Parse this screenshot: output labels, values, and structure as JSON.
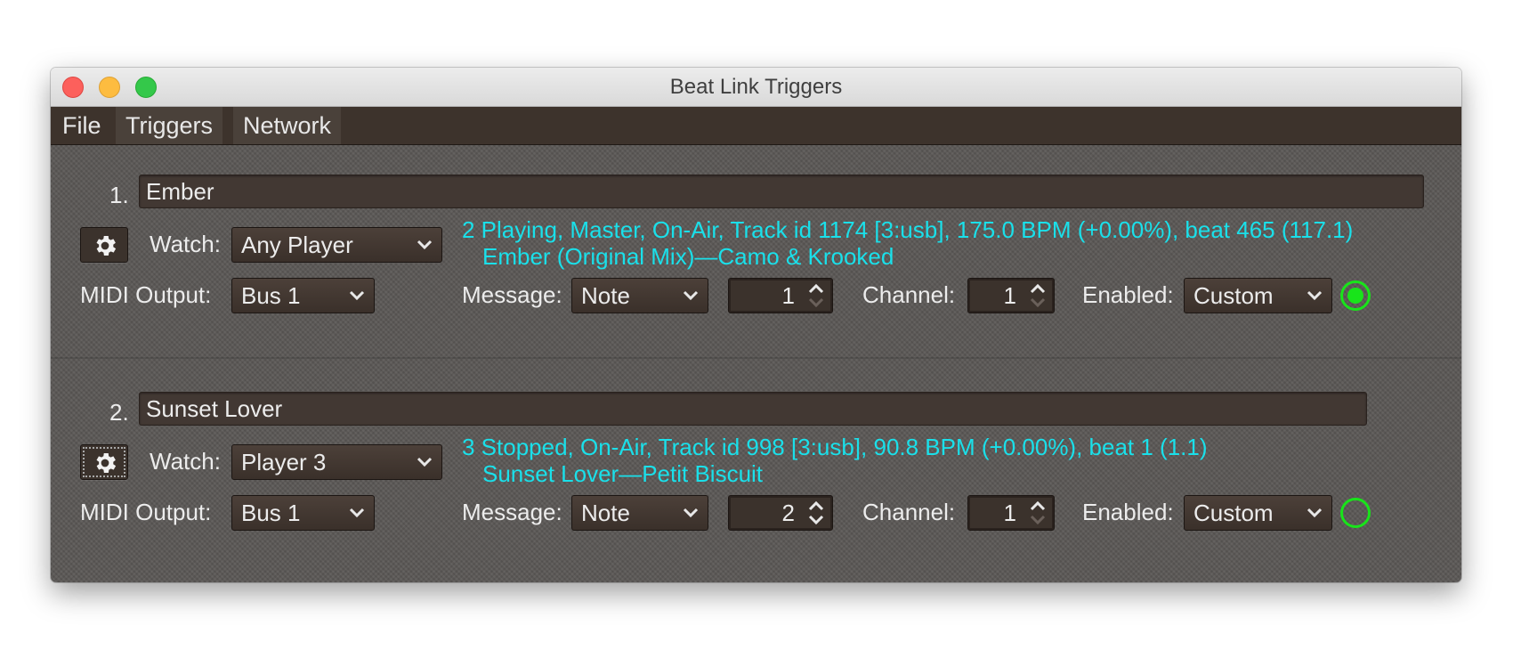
{
  "window": {
    "title": "Beat Link Triggers"
  },
  "menubar": [
    "File",
    "Triggers",
    "Network"
  ],
  "labels": {
    "watch": "Watch:",
    "midi_output": "MIDI Output:",
    "message": "Message:",
    "channel": "Channel:",
    "enabled": "Enabled:"
  },
  "triggers": [
    {
      "index": "1.",
      "name": "Ember",
      "watch": "Any Player",
      "status_line1": "2 Playing, Master, On-Air, Track id 1174 [3:usb], 175.0 BPM (+0.00%), beat 465 (117.1)",
      "status_line2": "Ember (Original Mix)—Camo & Krooked",
      "midi_output": "Bus 1",
      "message": "Note",
      "note": "1",
      "channel": "1",
      "enabled": "Custom",
      "active": true
    },
    {
      "index": "2.",
      "name": "Sunset Lover",
      "watch": "Player 3",
      "status_line1": "3 Stopped, On-Air, Track id 998 [3:usb], 90.8 BPM (+0.00%), beat 1 (1.1)",
      "status_line2": "Sunset Lover—Petit Biscuit",
      "midi_output": "Bus 1",
      "message": "Note",
      "note": "2",
      "channel": "1",
      "enabled": "Custom",
      "active": false
    }
  ],
  "colors": {
    "status_text": "#1ae0ea",
    "indicator": "#18e41a",
    "background": "#5a5755"
  }
}
